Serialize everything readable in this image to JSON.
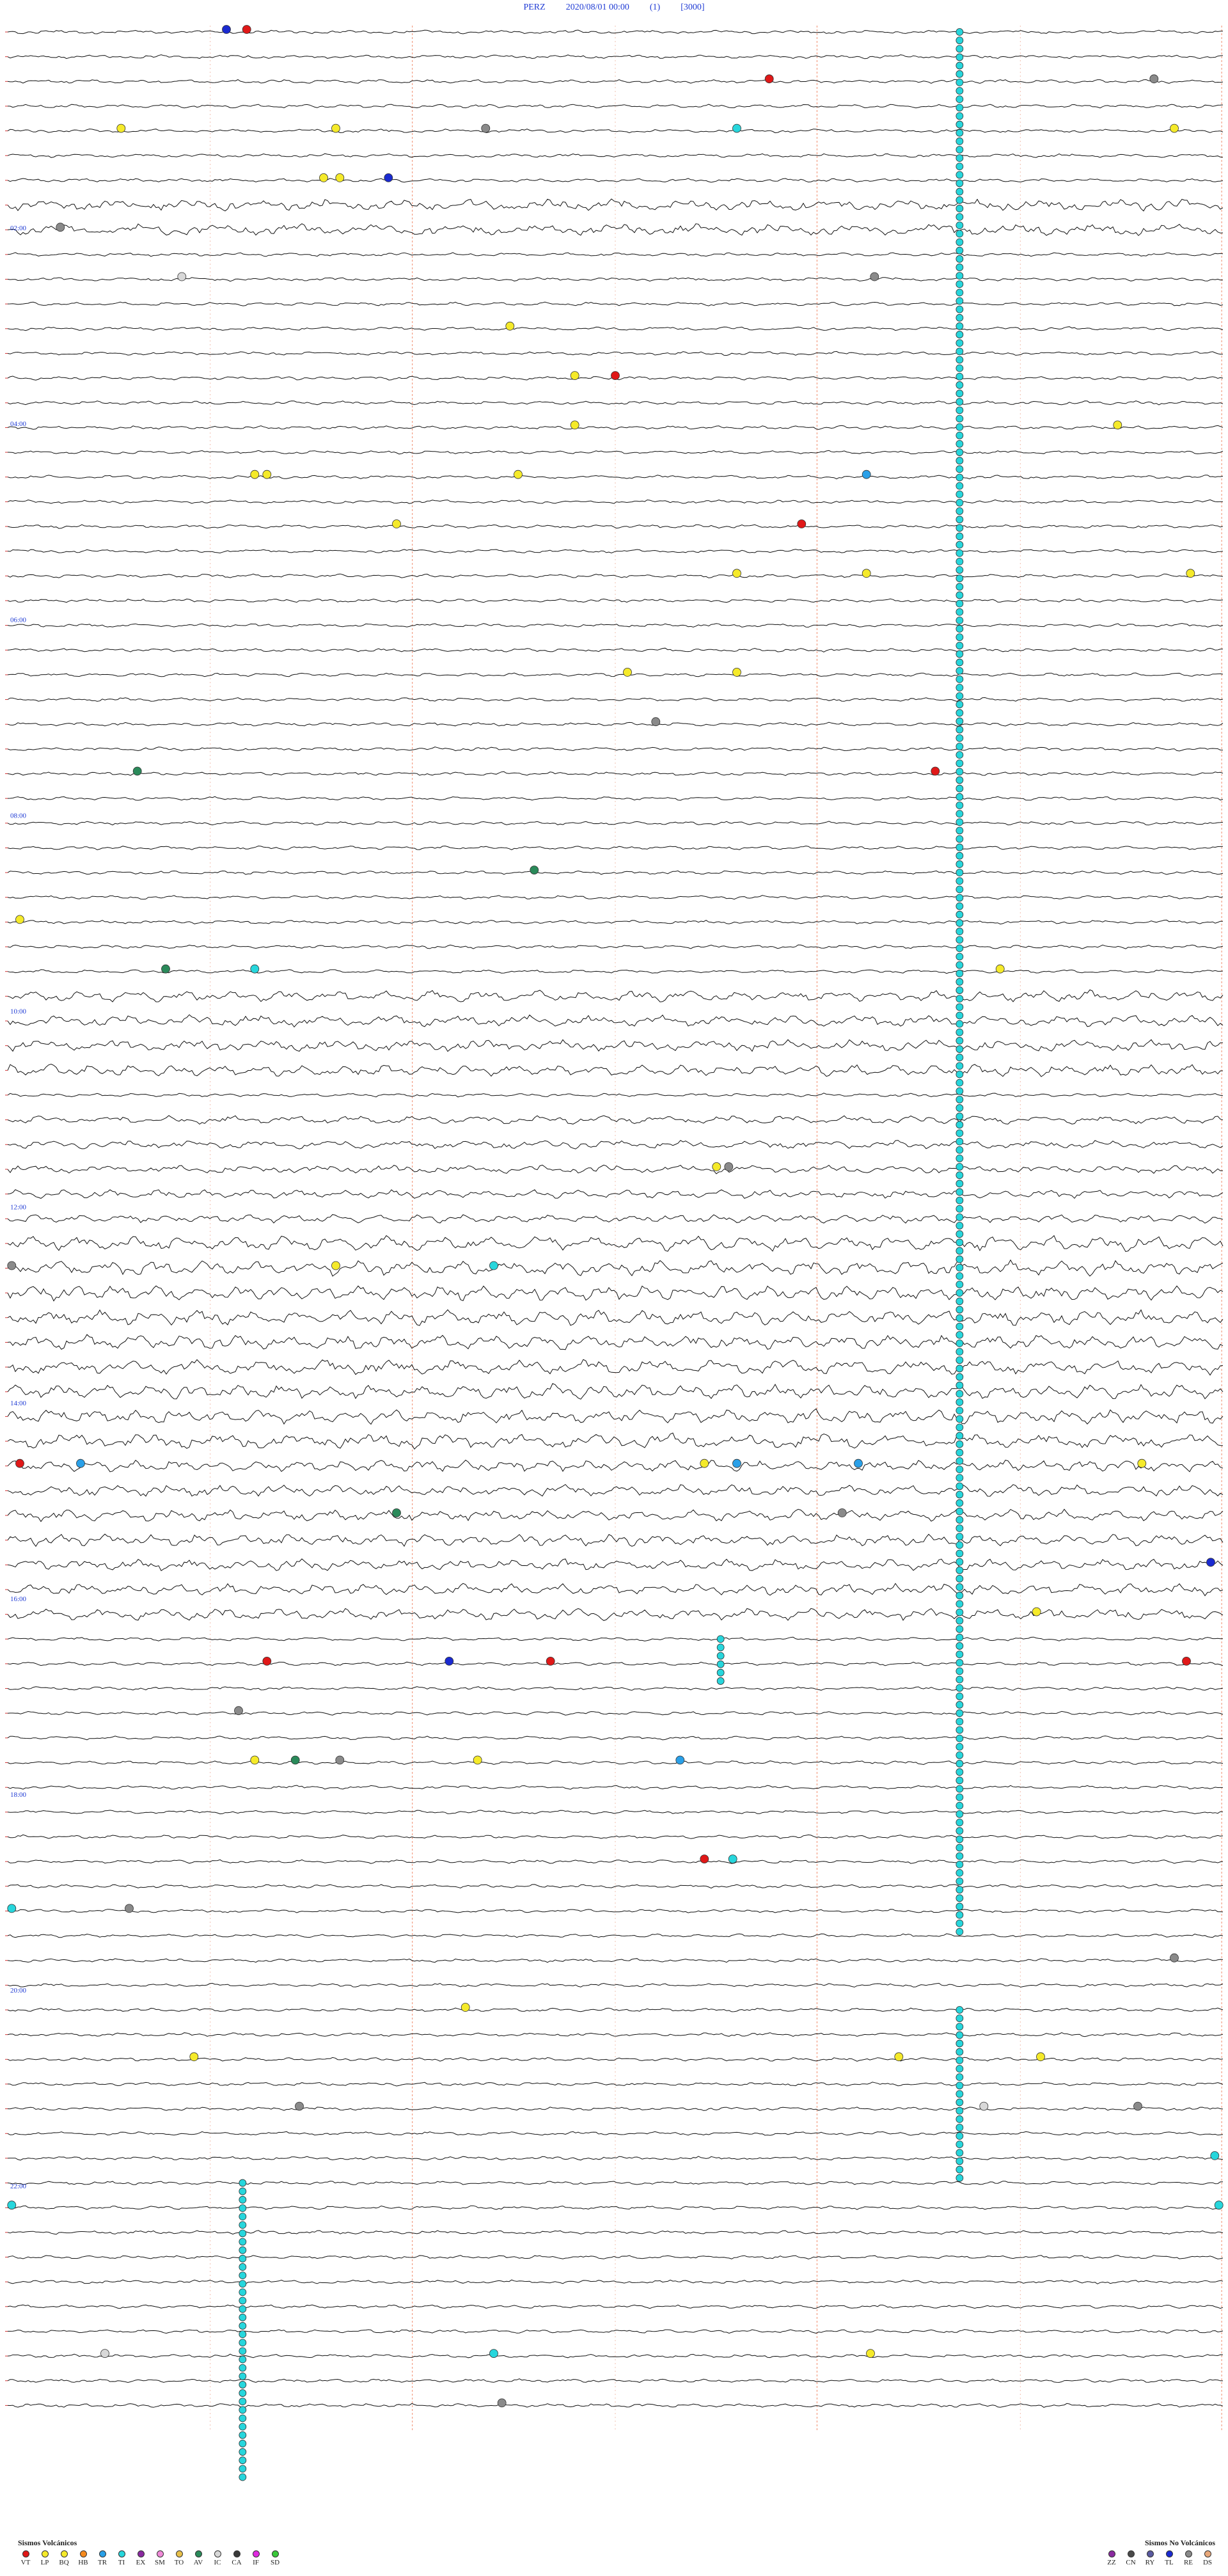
{
  "header": {
    "station": "PERZ",
    "datetime": "2020/08/01 00:00",
    "channel": "(1)",
    "scale": "[3000]"
  },
  "chart_data": {
    "type": "seismogram",
    "trace_count": 48,
    "minutes_per_trace": 30,
    "hour_labels": [
      "02:00",
      "04:00",
      "06:00",
      "08:00",
      "10:00",
      "12:00",
      "14:00",
      "16:00",
      "18:00",
      "20:00",
      "22:00"
    ],
    "hour_label_traces": [
      4,
      8,
      12,
      16,
      20,
      24,
      28,
      32,
      36,
      40,
      44
    ],
    "colors": {
      "VT": "#e01818",
      "LP": "#f5ea2a",
      "HB": "#f58a1e",
      "TR": "#2aa0e8",
      "TI": "#27d6dc",
      "EX": "#8a2aa0",
      "SM": "#f08ad8",
      "TO": "#e8c04a",
      "AV": "#2a8a5a",
      "IC": "#d8d8d8",
      "CA": "#3a3a3a",
      "IF": "#e02ae0",
      "SD": "#3ac83a",
      "ZZ": "#8a2aa0",
      "CN": "#4a4a4a",
      "RY": "#5a5aa0",
      "TL": "#1a2ad0",
      "RE": "#8a8a8a",
      "DS": "#e8a87a"
    },
    "events": [
      {
        "trace": 0,
        "minute": 5.4,
        "type": "TL"
      },
      {
        "trace": 0,
        "minute": 5.9,
        "type": "VT"
      },
      {
        "trace": 1,
        "minute": 18.8,
        "type": "VT"
      },
      {
        "trace": 1,
        "minute": 28.3,
        "type": "RE"
      },
      {
        "trace": 2,
        "minute": 18.0,
        "type": "TI"
      },
      {
        "trace": 2,
        "minute": 28.8,
        "type": "LP"
      },
      {
        "trace": 2,
        "minute": 2.8,
        "type": "LP"
      },
      {
        "trace": 2,
        "minute": 8.1,
        "type": "LP"
      },
      {
        "trace": 2,
        "minute": 11.8,
        "type": "RE"
      },
      {
        "trace": 3,
        "minute": 7.8,
        "type": "LP"
      },
      {
        "trace": 3,
        "minute": 8.2,
        "type": "LP"
      },
      {
        "trace": 3,
        "minute": 9.4,
        "type": "TL"
      },
      {
        "trace": 4,
        "minute": 1.3,
        "type": "RE"
      },
      {
        "trace": 5,
        "minute": 4.3,
        "type": "IC"
      },
      {
        "trace": 5,
        "minute": 21.4,
        "type": "RE"
      },
      {
        "trace": 6,
        "minute": 12.4,
        "type": "LP"
      },
      {
        "trace": 7,
        "minute": 14.0,
        "type": "LP"
      },
      {
        "trace": 7,
        "minute": 15.0,
        "type": "VT"
      },
      {
        "trace": 8,
        "minute": 14.0,
        "type": "LP"
      },
      {
        "trace": 8,
        "minute": 27.4,
        "type": "LP"
      },
      {
        "trace": 9,
        "minute": 6.1,
        "type": "LP"
      },
      {
        "trace": 9,
        "minute": 12.6,
        "type": "LP"
      },
      {
        "trace": 9,
        "minute": 6.4,
        "type": "LP"
      },
      {
        "trace": 9,
        "minute": 21.2,
        "type": "TR"
      },
      {
        "trace": 10,
        "minute": 19.6,
        "type": "VT"
      },
      {
        "trace": 10,
        "minute": 9.6,
        "type": "LP"
      },
      {
        "trace": 11,
        "minute": 18.0,
        "type": "LP"
      },
      {
        "trace": 11,
        "minute": 21.2,
        "type": "LP"
      },
      {
        "trace": 11,
        "minute": 29.2,
        "type": "LP"
      },
      {
        "trace": 13,
        "minute": 15.3,
        "type": "LP"
      },
      {
        "trace": 13,
        "minute": 18.0,
        "type": "LP"
      },
      {
        "trace": 14,
        "minute": 16.0,
        "type": "RE"
      },
      {
        "trace": 15,
        "minute": 3.2,
        "type": "AV"
      },
      {
        "trace": 15,
        "minute": 22.9,
        "type": "VT"
      },
      {
        "trace": 17,
        "minute": 13.0,
        "type": "AV"
      },
      {
        "trace": 18,
        "minute": 0.3,
        "type": "LP"
      },
      {
        "trace": 19,
        "minute": 3.9,
        "type": "AV"
      },
      {
        "trace": 19,
        "minute": 24.5,
        "type": "LP"
      },
      {
        "trace": 19,
        "minute": 6.1,
        "type": "TI"
      },
      {
        "trace": 23,
        "minute": 17.5,
        "type": "LP"
      },
      {
        "trace": 23,
        "minute": 17.8,
        "type": "RE"
      },
      {
        "trace": 25,
        "minute": 0.1,
        "type": "RE"
      },
      {
        "trace": 25,
        "minute": 8.1,
        "type": "LP"
      },
      {
        "trace": 25,
        "minute": 12.0,
        "type": "TI"
      },
      {
        "trace": 29,
        "minute": 0.3,
        "type": "VT"
      },
      {
        "trace": 29,
        "minute": 1.8,
        "type": "TR"
      },
      {
        "trace": 29,
        "minute": 17.2,
        "type": "LP"
      },
      {
        "trace": 29,
        "minute": 18.0,
        "type": "TR"
      },
      {
        "trace": 29,
        "minute": 21.0,
        "type": "TR"
      },
      {
        "trace": 29,
        "minute": 28.0,
        "type": "LP"
      },
      {
        "trace": 30,
        "minute": 9.6,
        "type": "AV"
      },
      {
        "trace": 30,
        "minute": 20.6,
        "type": "RE"
      },
      {
        "trace": 31,
        "minute": 29.7,
        "type": "TL"
      },
      {
        "trace": 32,
        "minute": 25.4,
        "type": "LP"
      },
      {
        "trace": 33,
        "minute": 6.4,
        "type": "VT"
      },
      {
        "trace": 33,
        "minute": 10.9,
        "type": "TL"
      },
      {
        "trace": 33,
        "minute": 13.4,
        "type": "VT"
      },
      {
        "trace": 33,
        "minute": 29.1,
        "type": "VT"
      },
      {
        "trace": 34,
        "minute": 5.7,
        "type": "RE"
      },
      {
        "trace": 35,
        "minute": 6.1,
        "type": "LP"
      },
      {
        "trace": 35,
        "minute": 7.1,
        "type": "AV"
      },
      {
        "trace": 35,
        "minute": 8.2,
        "type": "RE"
      },
      {
        "trace": 35,
        "minute": 11.6,
        "type": "LP"
      },
      {
        "trace": 35,
        "minute": 16.6,
        "type": "TR"
      },
      {
        "trace": 37,
        "minute": 17.2,
        "type": "VT"
      },
      {
        "trace": 37,
        "minute": 17.9,
        "type": "TI"
      },
      {
        "trace": 38,
        "minute": 0.1,
        "type": "TI"
      },
      {
        "trace": 38,
        "minute": 3.0,
        "type": "RE"
      },
      {
        "trace": 39,
        "minute": 28.8,
        "type": "RE"
      },
      {
        "trace": 40,
        "minute": 11.3,
        "type": "LP"
      },
      {
        "trace": 41,
        "minute": 4.6,
        "type": "LP"
      },
      {
        "trace": 41,
        "minute": 22.0,
        "type": "LP"
      },
      {
        "trace": 41,
        "minute": 25.5,
        "type": "LP"
      },
      {
        "trace": 42,
        "minute": 7.2,
        "type": "RE"
      },
      {
        "trace": 42,
        "minute": 24.1,
        "type": "IC"
      },
      {
        "trace": 42,
        "minute": 27.9,
        "type": "RE"
      },
      {
        "trace": 43,
        "minute": 29.8,
        "type": "TI"
      },
      {
        "trace": 44,
        "minute": 0.1,
        "type": "TI"
      },
      {
        "trace": 44,
        "minute": 29.9,
        "type": "TI"
      },
      {
        "trace": 47,
        "minute": 2.4,
        "type": "IC"
      },
      {
        "trace": 47,
        "minute": 12.0,
        "type": "TI"
      },
      {
        "trace": 47,
        "minute": 21.3,
        "type": "LP"
      },
      {
        "trace": 48,
        "minute": 12.2,
        "type": "RE"
      }
    ]
  },
  "legend_volcanic": {
    "title": "Sismos Volcánicos",
    "items": [
      {
        "code": "VT",
        "color": "#e01818"
      },
      {
        "code": "LP",
        "color": "#f5ea2a"
      },
      {
        "code": "BQ",
        "color": "#f5ea2a"
      },
      {
        "code": "HB",
        "color": "#f58a1e"
      },
      {
        "code": "TR",
        "color": "#2aa0e8"
      },
      {
        "code": "TI",
        "color": "#27d6dc"
      },
      {
        "code": "EX",
        "color": "#8a2aa0"
      },
      {
        "code": "SM",
        "color": "#f08ad8"
      },
      {
        "code": "TO",
        "color": "#e8c04a"
      },
      {
        "code": "AV",
        "color": "#2a8a5a"
      },
      {
        "code": "IC",
        "color": "#d8d8d8"
      },
      {
        "code": "CA",
        "color": "#3a3a3a"
      },
      {
        "code": "IF",
        "color": "#e02ae0"
      },
      {
        "code": "SD",
        "color": "#3ac83a"
      }
    ]
  },
  "legend_nonvolcanic": {
    "title": "Sismos No Volcánicos",
    "items": [
      {
        "code": "ZZ",
        "color": "#8a2aa0"
      },
      {
        "code": "CN",
        "color": "#4a4a4a"
      },
      {
        "code": "RY",
        "color": "#5a5aa0"
      },
      {
        "code": "TL",
        "color": "#1a2ad0"
      },
      {
        "code": "RE",
        "color": "#8a8a8a"
      },
      {
        "code": "DS",
        "color": "#e8a87a"
      }
    ]
  }
}
